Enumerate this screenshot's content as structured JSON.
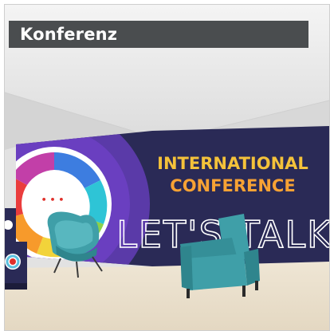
{
  "card": {
    "title": "Konferenz"
  },
  "banner": {
    "line1": "INTERNATIONAL",
    "line2": "CONFERENCE",
    "slogan": "LET'S TALK!",
    "bubble_dots": "• • •"
  },
  "colors": {
    "title_bar": "#4a4d4f",
    "banner_navy": "#2a2a56",
    "banner_purple": "#5a3aa8",
    "headline_orange": "#f7a234",
    "headline_yellow": "#f4c23a",
    "chair_teal": "#3f9fa8",
    "floor": "#ece3d2"
  },
  "icons": {
    "speech_bubble": "speech-bubble-icon",
    "color_wheel": "color-wheel-icon"
  }
}
